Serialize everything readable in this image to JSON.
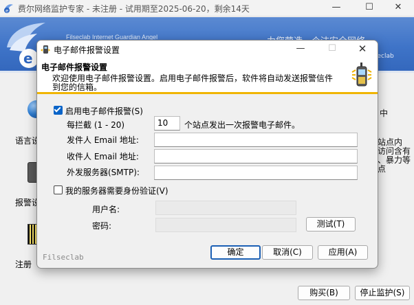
{
  "main_window": {
    "title": "费尔网络监护专家 - 未注册 - 试用期至2025-06-20，剩余14天",
    "controls": {
      "minimize": "—",
      "maximize": "☐",
      "close": "✕"
    },
    "banner": {
      "brand": "Filseclab Internet Guardian Angel",
      "slogan": "力您营造一个洁",
      "slogan_tail": "安全网络",
      "suite": "05 Filseclab"
    },
    "side_items": [
      {
        "label": "语言设",
        "icon": "globe-icon"
      },
      {
        "label": "报警设",
        "icon": "phone-icon"
      },
      {
        "label": "注册",
        "icon": "barcode-icon"
      }
    ],
    "right_texts": [
      "中",
      "站点内",
      "访问含有",
      "、暴力等",
      "点"
    ],
    "buttons": {
      "buy": "购买(B)",
      "stop": "停止监护(S)"
    }
  },
  "dialog": {
    "title": "电子邮件报警设置",
    "controls": {
      "minimize": "—",
      "maximize": "☐",
      "close": "✕"
    },
    "header": {
      "title": "电子邮件报警设置",
      "desc_line1": "欢迎使用电子邮件报警设置。启用电子邮件报警后，软件将自动发送报警信件",
      "desc_line2": "到您的信箱。"
    },
    "enable_email": {
      "label": "启用电子邮件报警(S)",
      "checked": true
    },
    "interval": {
      "prefix": "每拦截 (1 - 20)",
      "value": "10",
      "suffix": "个站点发出一次报警电子邮件。"
    },
    "sender": {
      "label": "发件人 Email 地址:",
      "value": ""
    },
    "recipient": {
      "label": "收件人 Email 地址:",
      "value": ""
    },
    "smtp": {
      "label": "外发服务器(SMTP):",
      "value": ""
    },
    "require_auth": {
      "label": "我的服务器需要身份验证(V)",
      "checked": false
    },
    "username": {
      "label": "用户名:",
      "value": ""
    },
    "password": {
      "label": "密码:",
      "value": ""
    },
    "buttons": {
      "test": "测试(T)",
      "ok": "确定",
      "cancel": "取消(C)",
      "apply": "应用(A)"
    },
    "footer_brand": "Filseclab"
  },
  "colors": {
    "banner_blue": "#3f74c8",
    "header_accent": "#f0b400",
    "checkbox_blue": "#0a64c8"
  }
}
